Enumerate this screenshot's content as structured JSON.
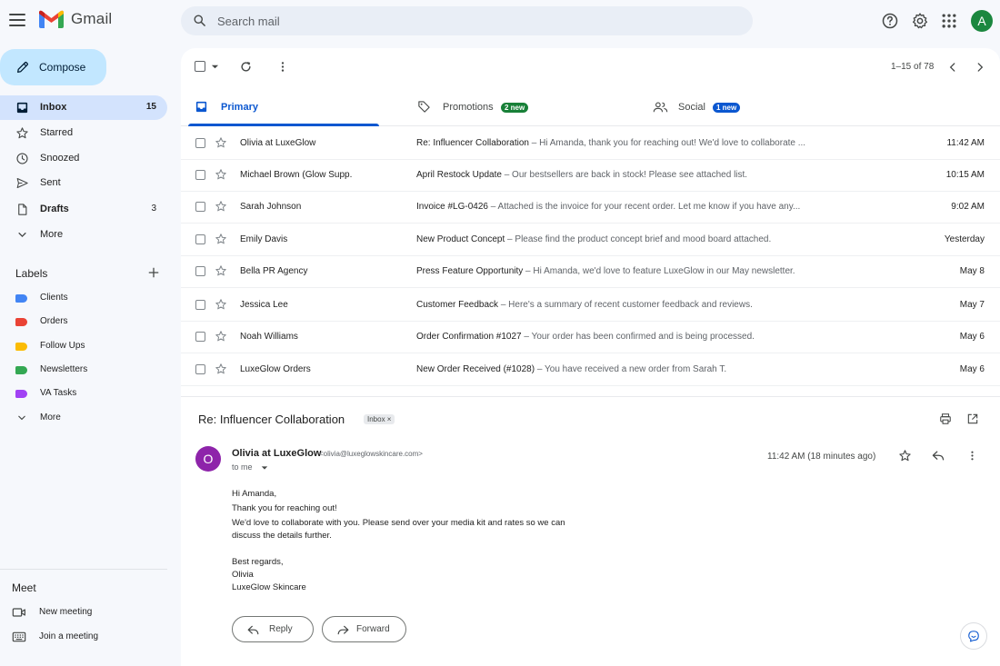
{
  "app": {
    "name": "Gmail",
    "avatar_letter": "A"
  },
  "search": {
    "placeholder": "Search mail",
    "value": ""
  },
  "compose": {
    "label": "Compose"
  },
  "nav": [
    {
      "label": "Inbox",
      "count": "15",
      "icon": "inbox-icon"
    },
    {
      "label": "Starred",
      "count": "",
      "icon": "star-icon"
    },
    {
      "label": "Snoozed",
      "count": "",
      "icon": "clock-icon"
    },
    {
      "label": "Sent",
      "count": "",
      "icon": "send-icon"
    },
    {
      "label": "Drafts",
      "count": "3",
      "icon": "draft-icon"
    },
    {
      "label": "More",
      "count": "",
      "icon": "chevron-down-icon"
    }
  ],
  "labels": {
    "heading": "Labels",
    "items": [
      {
        "label": "Clients",
        "color": "#4285f4"
      },
      {
        "label": "Orders",
        "color": "#ea4335"
      },
      {
        "label": "Follow Ups",
        "color": "#fbbc04"
      },
      {
        "label": "Newsletters",
        "color": "#34a853"
      },
      {
        "label": "VA Tasks",
        "color": "#a142f4"
      }
    ],
    "more": "More"
  },
  "meet": {
    "heading": "Meet",
    "new_meeting": "New meeting",
    "join_meeting": "Join a meeting"
  },
  "toolbar": {
    "pagination": "1–15 of 78"
  },
  "tabs": [
    {
      "label": "Primary",
      "badge": "",
      "badge_color": ""
    },
    {
      "label": "Promotions",
      "badge": "2 new",
      "badge_color": "#188038"
    },
    {
      "label": "Social",
      "badge": "1 new",
      "badge_color": "#0b57d0"
    }
  ],
  "emails": [
    {
      "sender": "Olivia at LuxeGlow",
      "subject": "Re: Influencer Collaboration",
      "snippet": " – Hi Amanda, thank you for reaching out! We'd love to collaborate ...",
      "time": "11:42 AM"
    },
    {
      "sender": "Michael Brown (Glow Supp.",
      "subject": "April Restock Update",
      "snippet": " – Our bestsellers are back in stock! Please see attached list.",
      "time": "10:15 AM"
    },
    {
      "sender": "Sarah Johnson",
      "subject": "Invoice #LG-0426",
      "snippet": " – Attached is the invoice for your recent order. Let me know if you have any...",
      "time": "9:02 AM"
    },
    {
      "sender": "Emily Davis",
      "subject": "New Product Concept",
      "snippet": " – Please find the product concept brief and mood board attached.",
      "time": "Yesterday"
    },
    {
      "sender": "Bella PR Agency",
      "subject": "Press Feature Opportunity",
      "snippet": " – Hi Amanda, we'd love to feature LuxeGlow in our May newsletter.",
      "time": "May 8"
    },
    {
      "sender": "Jessica Lee",
      "subject": "Customer Feedback",
      "snippet": " – Here's a summary of recent customer feedback and reviews.",
      "time": "May 7"
    },
    {
      "sender": "Noah Williams",
      "subject": "Order Confirmation #1027",
      "snippet": " – Your order has been confirmed and is being processed.",
      "time": "May 6"
    },
    {
      "sender": "LuxeGlow Orders",
      "subject": "New Order Received (#1028)",
      "snippet": " – You have received a new order from Sarah T.",
      "time": "May 6"
    }
  ],
  "message": {
    "subject": "Re: Influencer Collaboration",
    "chip": "Inbox ×",
    "avatar_letter": "O",
    "from_name": "Olivia at LuxeGlow",
    "from_email": "<olivia@luxeglowskincare.com>",
    "to": "to me",
    "time": "11:42 AM (18 minutes ago)",
    "body": [
      "Hi Amanda,",
      "Thank you for reaching out!",
      "We'd love to collaborate with you. Please send over your media kit and rates so we can",
      "discuss the details further.",
      "Best regards,",
      "Olivia",
      "LuxeGlow Skincare"
    ],
    "reply_label": "Reply",
    "forward_label": "Forward"
  }
}
